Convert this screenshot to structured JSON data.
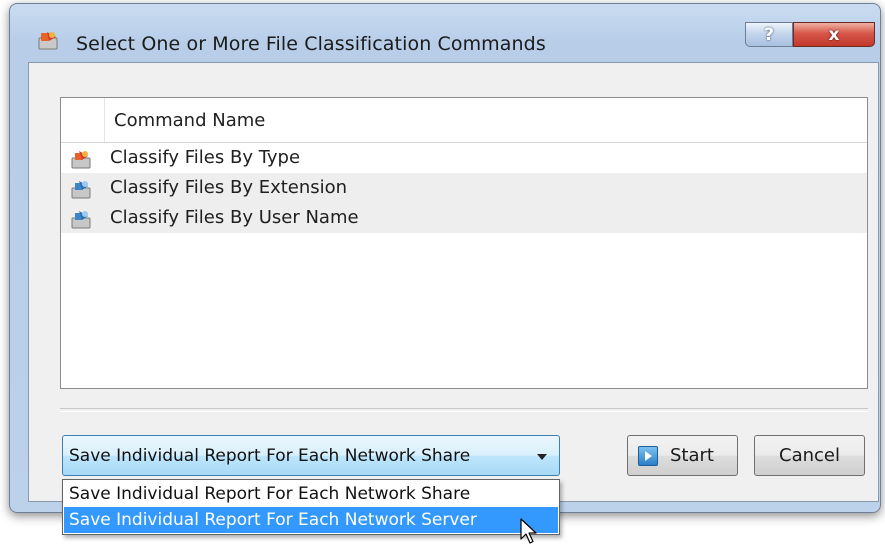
{
  "window": {
    "title": "Select One or More File Classification Commands",
    "help_label": "?",
    "close_label": "x"
  },
  "list": {
    "column_header": "Command Name",
    "items": [
      {
        "label": "Classify Files By Type"
      },
      {
        "label": "Classify Files By Extension"
      },
      {
        "label": "Classify Files By User Name"
      }
    ]
  },
  "report_mode": {
    "selected": "Save Individual Report For Each Network Share",
    "options": [
      "Save Individual Report For Each Network Share",
      "Save Individual Report For Each Network Server"
    ],
    "highlighted_index": 1
  },
  "buttons": {
    "start_label": "Start",
    "cancel_label": "Cancel"
  },
  "colors": {
    "selection": "#3399ff",
    "close_button": "#c2382b",
    "frame": "#b7cde8"
  }
}
